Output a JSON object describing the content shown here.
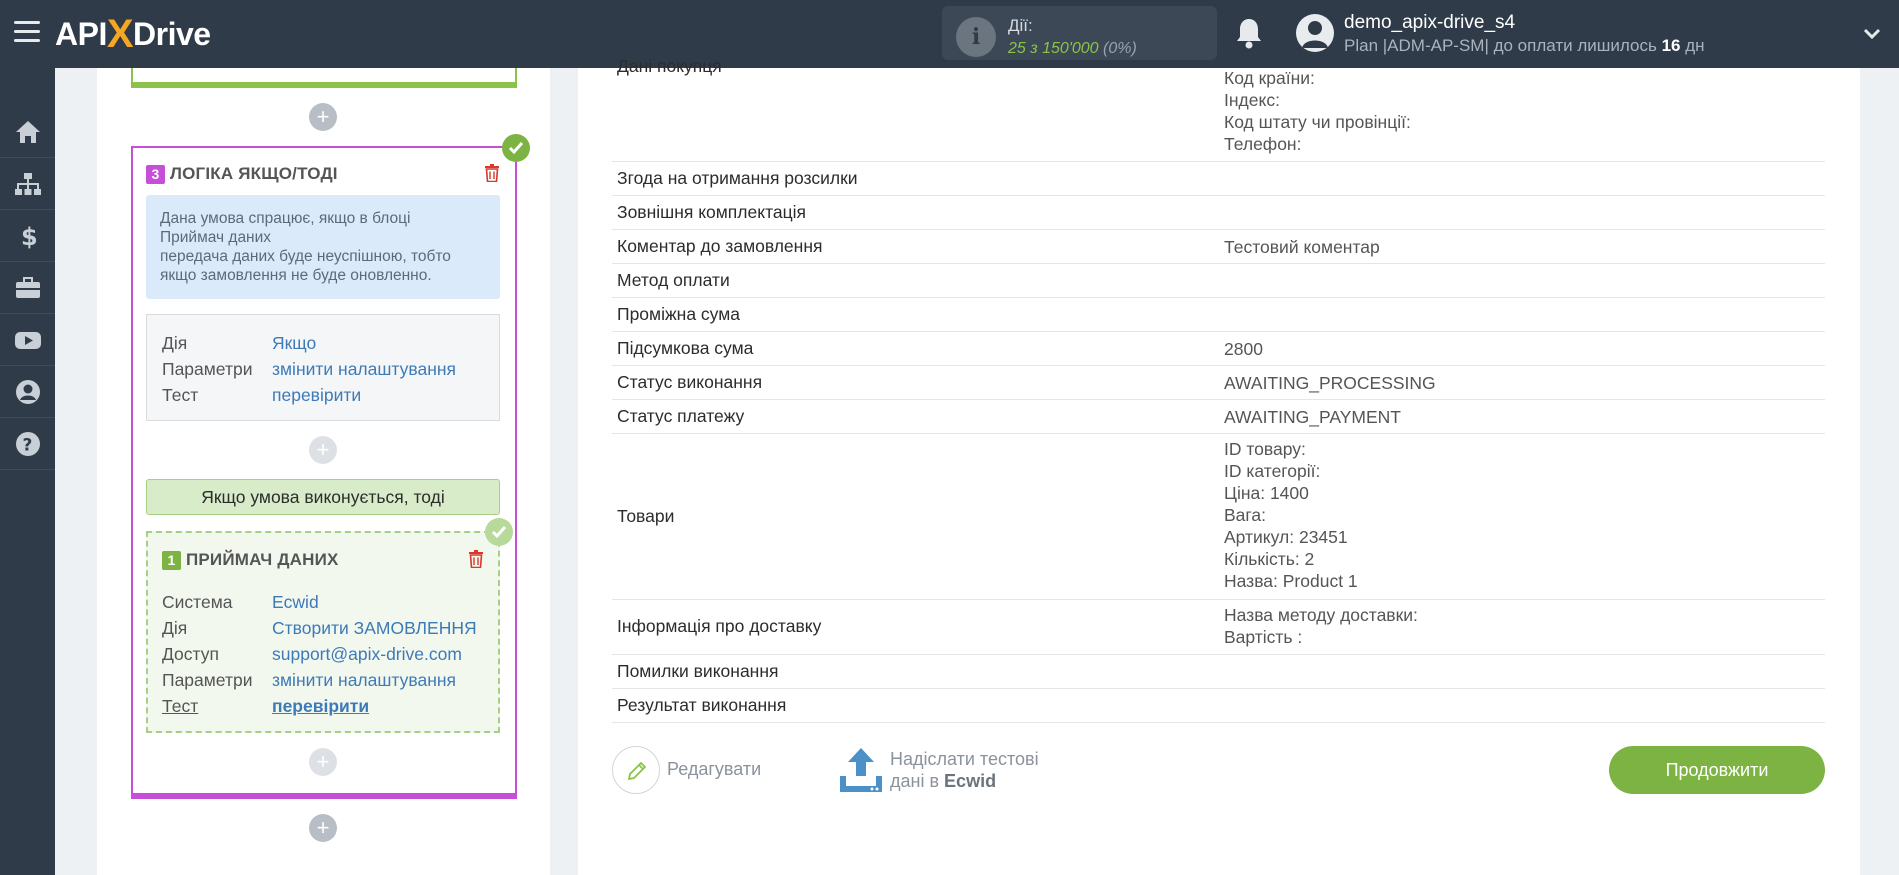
{
  "header": {
    "logo_text": "APIXDrive",
    "actions_label": "Дії:",
    "actions_value": "25 з 150'000",
    "actions_pct": "(0%)",
    "username": "demo_apix-drive_s4",
    "plan_prefix": "Plan |ADM-AP-SM| до оплати лишилось",
    "plan_days": "16",
    "plan_suffix": "дн"
  },
  "sidebar": {
    "icons": [
      "home-icon",
      "sitemap-icon",
      "dollar-icon",
      "briefcase-icon",
      "youtube-icon",
      "user-icon",
      "help-icon"
    ]
  },
  "logic_block": {
    "number": "3",
    "title": "ЛОГІКА ЯКЩО/ТОДІ",
    "note_line1": "Дана умова спрацює, якщо в блоці",
    "note_line2": "Приймач даних",
    "note_line3": "передача даних буде неуспішною, тобто",
    "note_line4": "якщо замовлення не буде оновленно.",
    "rows": [
      {
        "key": "Дія",
        "value": "Якщо"
      },
      {
        "key": "Параметри",
        "value": "змінити налаштування"
      },
      {
        "key": "Тест",
        "value": "перевірити"
      }
    ],
    "condition_label": "Якщо умова виконується, тоді"
  },
  "receiver_block": {
    "number": "1",
    "title": "ПРИЙМАЧ ДАНИХ",
    "rows": [
      {
        "key": "Система",
        "value": "Ecwid"
      },
      {
        "key": "Дія",
        "value": "Створити ЗАМОВЛЕННЯ"
      },
      {
        "key": "Доступ",
        "value": "support@apix-drive.com"
      },
      {
        "key": "Параметри",
        "value": "змінити налаштування"
      },
      {
        "key": "Тест",
        "value": "перевірити"
      }
    ]
  },
  "table": {
    "buyer": {
      "label": "Дані покупця",
      "lines": [
        "Код країни:",
        "Індекс:",
        "Код штату чи провінції:",
        "Телефон:"
      ]
    },
    "rows": [
      {
        "label": "Згода на отримання розсилки",
        "value": ""
      },
      {
        "label": "Зовнішня комплектація",
        "value": ""
      },
      {
        "label": "Коментар до замовлення",
        "value": "Тестовий коментар"
      },
      {
        "label": "Метод оплати",
        "value": ""
      },
      {
        "label": "Проміжна сума",
        "value": ""
      },
      {
        "label": "Підсумкова сума",
        "value": "2800"
      },
      {
        "label": "Статус виконання",
        "value": "AWAITING_PROCESSING"
      },
      {
        "label": "Статус платежу",
        "value": "AWAITING_PAYMENT"
      }
    ],
    "goods": {
      "label": "Товари",
      "lines": [
        "ID товару:",
        "ID категорії:",
        "Ціна: 1400",
        "Вага:",
        "Артикул: 23451",
        "Кількість: 2",
        "Назва: Product 1"
      ]
    },
    "delivery": {
      "label": "Інформація про доставку",
      "lines": [
        "Назва методу доставки:",
        "Вартість :"
      ]
    },
    "tail_rows": [
      {
        "label": "Помилки виконання",
        "value": ""
      },
      {
        "label": "Результат виконання",
        "value": ""
      }
    ]
  },
  "footer": {
    "edit_label": "Редагувати",
    "send_line1": "Надіслати тестові",
    "send_line2_prefix": "дані в",
    "send_line2_system": "Ecwid",
    "continue_label": "Продовжити"
  },
  "colors": {
    "topbar": "#2f3b48",
    "accent_green": "#7cb342",
    "logic_border": "#c74ed9",
    "link": "#3d7ab8"
  }
}
